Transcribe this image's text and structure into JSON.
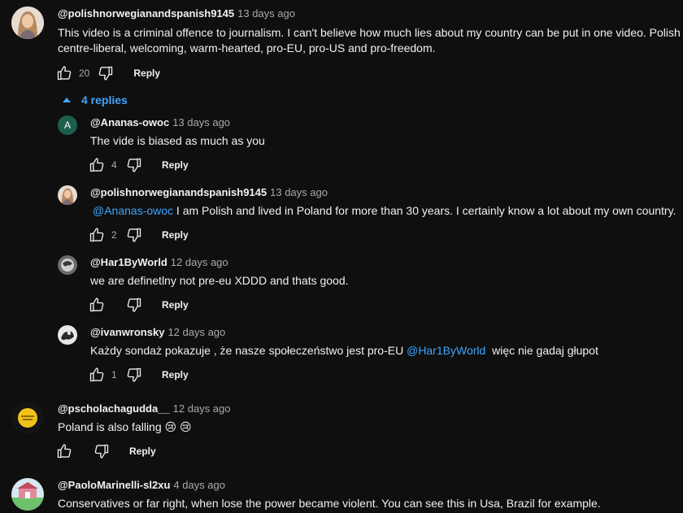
{
  "comments": [
    {
      "author": "@polishnorwegianandspanish9145",
      "time": "13 days ago",
      "text": "This video is a criminal offence to journalism. I can't believe how much lies about my country can be put in one video. Polish",
      "text2": "centre-liberal, welcoming, warm-hearted, pro-EU, pro-US and pro-freedom.",
      "likes": "20",
      "reply_label": "Reply",
      "replies_toggle": "4 replies"
    },
    {
      "author": "@Ananas-owoc",
      "time": "13 days ago",
      "avatar_letter": "A",
      "text": "The vide is biased as much as you",
      "likes": "4",
      "reply_label": "Reply"
    },
    {
      "author": "@polishnorwegianandspanish9145",
      "time": "13 days ago",
      "mention": "@Ananas-owoc",
      "text": " I am Polish and lived in Poland for more than 30 years. I certainly know a lot about my own country.",
      "likes": "2",
      "reply_label": "Reply"
    },
    {
      "author": "@Har1ByWorld",
      "time": "12 days ago",
      "text": "we are definetlny not pre-eu XDDD and thats good.",
      "likes": "",
      "reply_label": "Reply"
    },
    {
      "author": "@ivanwronsky",
      "time": "12 days ago",
      "text_before": "Każdy sondaż pokazuje , że nasze społeczeństwo jest pro-EU ",
      "mention": "@Har1ByWorld",
      "text_after": "  więc nie gadaj głupot",
      "likes": "1",
      "reply_label": "Reply"
    },
    {
      "author": "@pscholachagudda__",
      "time": "12 days ago",
      "text": "Poland is also falling 😢 😢",
      "likes": "",
      "reply_label": "Reply"
    },
    {
      "author": "@PaoloMarinelli-sl2xu",
      "time": "4 days ago",
      "text": "Conservatives or far right, when lose the power became violent. You can see this in Usa, Brazil for example."
    }
  ],
  "colors": {
    "background": "#0f0f0f",
    "link": "#3ea6ff",
    "muted": "#aaaaaa",
    "ananas_avatar": "#1e5e4e"
  },
  "icons": [
    "thumb-up-icon",
    "thumb-down-icon",
    "caret-up-icon"
  ]
}
